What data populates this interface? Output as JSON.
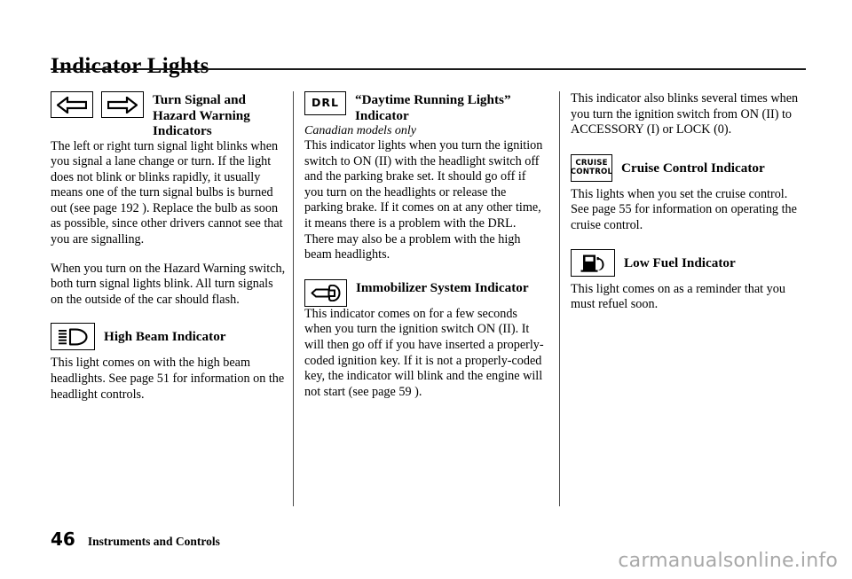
{
  "document": {
    "title": "Indicator Lights",
    "page_number": "46",
    "footer_section": "Instruments and Controls",
    "watermark": "carmanualsonline.info"
  },
  "columns": [
    {
      "id": "column-1",
      "entries": [
        {
          "icons": [
            "turn-signal-left-arrow-icon",
            "turn-signal-right-arrow-icon"
          ],
          "heading": "Turn Signal and Hazard Warning Indicators",
          "paragraphs": [
            "The left or right turn signal light blinks when you signal a lane change or turn. If the light does not blink or blinks rapidly, it usually means one of the turn signal bulbs is burned out (see page 192 ). Replace the bulb as soon as possible, since other drivers cannot see that you are signalling.",
            "When you turn on the Hazard Warning switch, both turn signal lights blink. All turn signals on the outside of the car should flash."
          ]
        },
        {
          "icons": [
            "high-beam-icon"
          ],
          "heading": "High Beam Indicator",
          "paragraphs": [
            "This light comes on with the high beam headlights. See page 51 for information on the headlight controls."
          ]
        }
      ]
    },
    {
      "id": "column-2",
      "entries": [
        {
          "icons": [
            "drl-icon"
          ],
          "icon_label": "DRL",
          "heading": "“Daytime Running Lights” Indicator",
          "subnote": "Canadian models only",
          "paragraphs": [
            "This indicator lights when you turn the ignition switch to ON (II) with the headlight switch off and the parking brake set. It should go off if you turn on the headlights or release the parking brake. If it comes on at any other time, it means there is a problem with the DRL. There may also be a problem with the high beam headlights."
          ]
        },
        {
          "icons": [
            "immobilizer-key-icon"
          ],
          "heading": "Immobilizer System Indicator",
          "paragraphs": [
            "This indicator comes on for a few seconds when you turn the ignition switch ON (II). It will then go off if you have inserted a properly-coded ignition key. If it is not a properly-coded key, the indicator will blink and the engine will not start (see page 59 )."
          ]
        }
      ]
    },
    {
      "id": "column-3",
      "entries": [
        {
          "icons": [],
          "heading": "",
          "paragraphs": [
            "This indicator also blinks several times when you turn the ignition switch from ON (II) to ACCESSORY (I) or LOCK (0)."
          ]
        },
        {
          "icons": [
            "cruise-control-icon"
          ],
          "icon_label_line1": "CRUISE",
          "icon_label_line2": "CONTROL",
          "heading": "Cruise Control Indicator",
          "paragraphs": [
            "This lights when you set the cruise control. See page 55 for information on operating the cruise control."
          ]
        },
        {
          "icons": [
            "low-fuel-pump-icon"
          ],
          "heading": "Low Fuel Indicator",
          "paragraphs": [
            "This light comes on as a reminder that you must refuel soon."
          ]
        }
      ]
    }
  ],
  "colors": {
    "ink": "#000000",
    "rule": "#1a1a1a",
    "divider": "#4a4a4a",
    "watermark": "#a8a8a8",
    "paper": "#ffffff"
  }
}
